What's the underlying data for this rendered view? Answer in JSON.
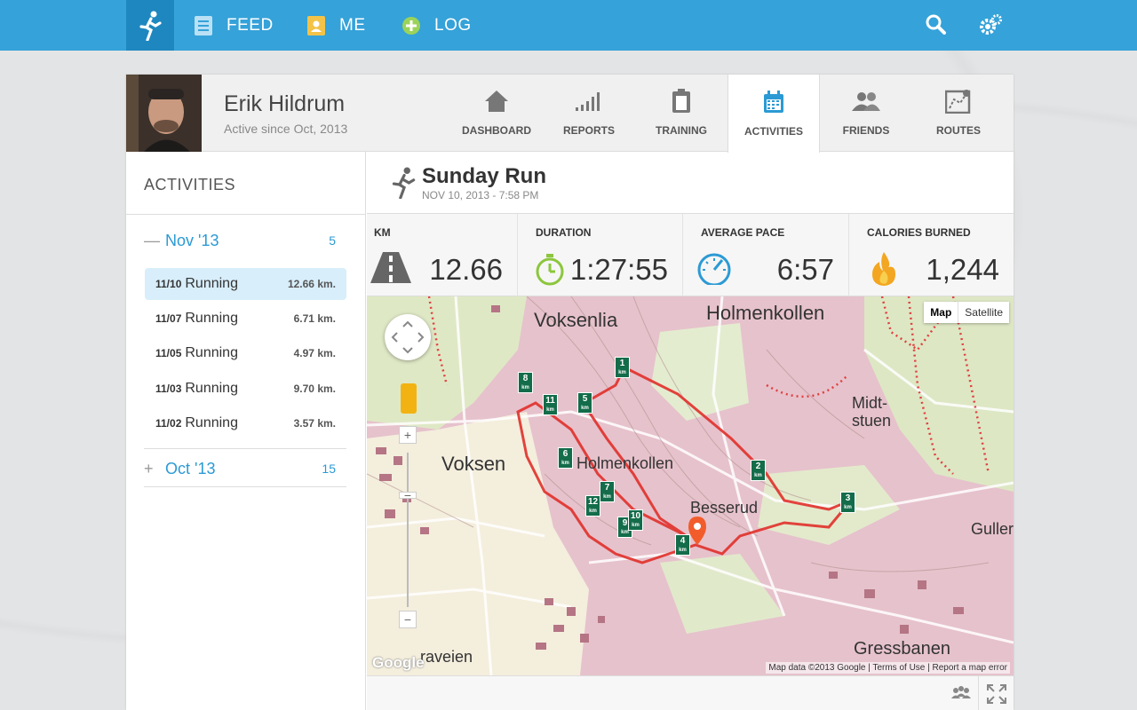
{
  "topbar": {
    "nav": [
      {
        "label": "FEED",
        "icon": "feed-icon"
      },
      {
        "label": "ME",
        "icon": "me-icon"
      },
      {
        "label": "LOG",
        "icon": "log-plus-icon"
      }
    ]
  },
  "profile": {
    "name": "Erik Hildrum",
    "since": "Active since Oct, 2013"
  },
  "tabs": [
    {
      "label": "DASHBOARD",
      "icon": "home-icon"
    },
    {
      "label": "REPORTS",
      "icon": "bars-icon"
    },
    {
      "label": "TRAINING",
      "icon": "clipboard-icon"
    },
    {
      "label": "ACTIVITIES",
      "icon": "calendar-icon",
      "active": true
    },
    {
      "label": "FRIENDS",
      "icon": "friends-icon"
    },
    {
      "label": "ROUTES",
      "icon": "route-icon"
    }
  ],
  "left": {
    "title": "ACTIVITIES",
    "months": [
      {
        "sign": "—",
        "label": "Nov '13",
        "count": "5"
      },
      {
        "sign": "+",
        "label": "Oct '13",
        "count": "15"
      }
    ],
    "activities": [
      {
        "date": "11/10",
        "type": "Running",
        "km": "12.66 km."
      },
      {
        "date": "11/07",
        "type": "Running",
        "km": "6.71 km."
      },
      {
        "date": "11/05",
        "type": "Running",
        "km": "4.97 km."
      },
      {
        "date": "11/03",
        "type": "Running",
        "km": "9.70 km."
      },
      {
        "date": "11/02",
        "type": "Running",
        "km": "3.57 km."
      }
    ]
  },
  "run": {
    "title": "Sunday Run",
    "date": "NOV 10, 2013  -  7:58 PM"
  },
  "stats": [
    {
      "label": "KM",
      "value": "12.66"
    },
    {
      "label": "DURATION",
      "value": "1:27:55"
    },
    {
      "label": "AVERAGE PACE",
      "value": "6:57"
    },
    {
      "label": "CALORIES BURNED",
      "value": "1,244"
    }
  ],
  "map": {
    "type_map": "Map",
    "type_satellite": "Satellite",
    "attribution": "Map data ©2013 Google  |  Terms of Use  |  Report a map error",
    "google": "Google",
    "places": [
      "Voksenlia",
      "Holmenkollen",
      "Voksen",
      "Holmenkollen",
      "Midt-stuen",
      "Besserud",
      "Gullerå",
      "Gressbanen",
      "raveien"
    ],
    "markers": [
      "1",
      "2",
      "3",
      "4",
      "5",
      "6",
      "7",
      "8",
      "9",
      "10",
      "11",
      "12"
    ]
  },
  "colors": {
    "brand": "#35a2d9",
    "route": "#e0302a",
    "selected": "#d8eefa"
  }
}
